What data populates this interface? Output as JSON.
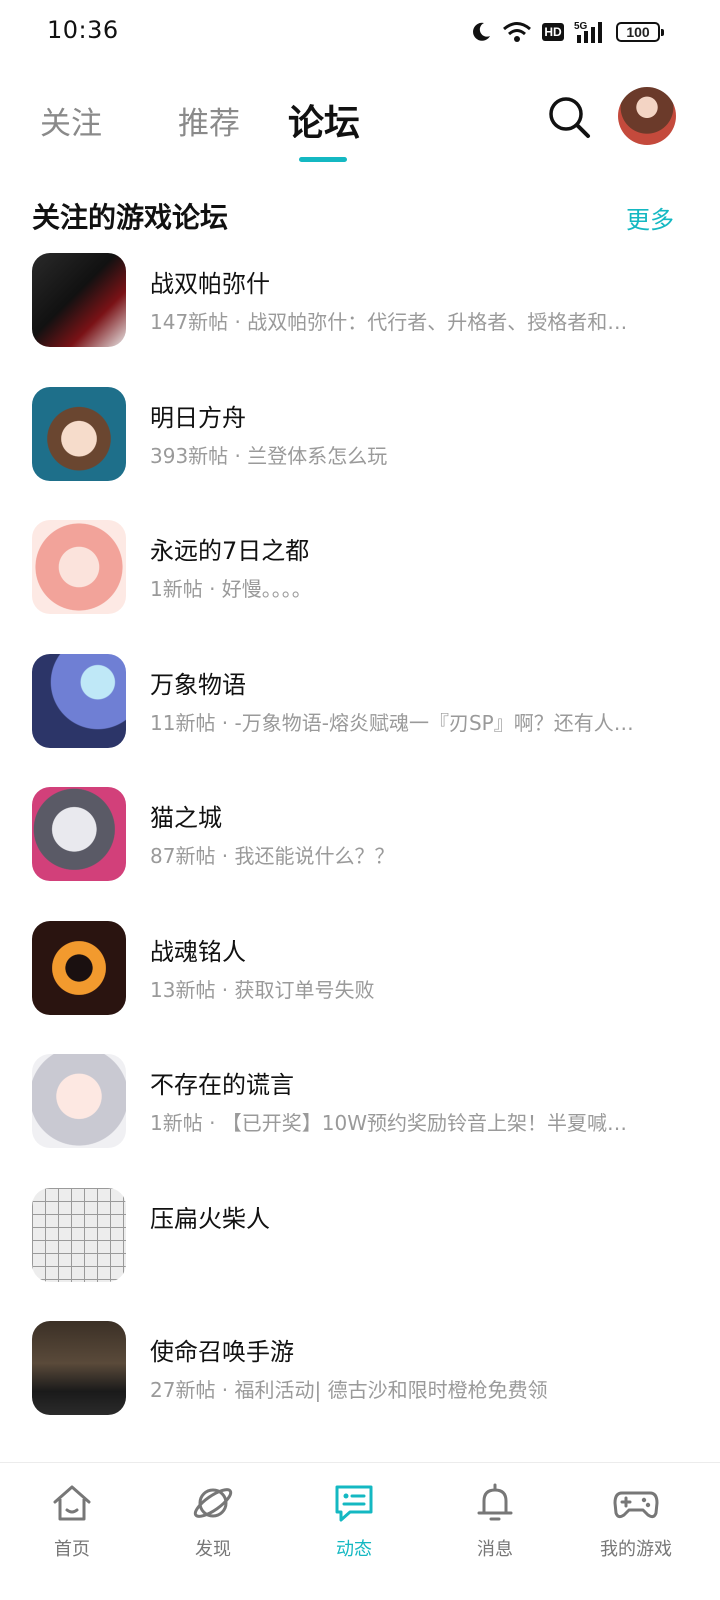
{
  "status_bar": {
    "time": "10:36",
    "hd": "HD",
    "network": "5G",
    "battery": "100"
  },
  "tabs": [
    {
      "label": "关注"
    },
    {
      "label": "推荐"
    },
    {
      "label": "论坛"
    }
  ],
  "section": {
    "title": "关注的游戏论坛",
    "more": "更多"
  },
  "forums": [
    {
      "name": "战双帕弥什",
      "meta": "147新帖 · 战双帕弥什：代行者、升格者、授格者和…",
      "icon": "game-punishing"
    },
    {
      "name": "明日方舟",
      "meta": "393新帖 · 兰登体系怎么玩",
      "icon": "game-arknights"
    },
    {
      "name": "永远的7日之都",
      "meta": "1新帖 · 好慢。。。。",
      "icon": "game-7days"
    },
    {
      "name": "万象物语",
      "meta": "11新帖 · -万象物语-熔炎赋魂一『刃SP』啊？还有人…",
      "icon": "game-sdorica"
    },
    {
      "name": "猫之城",
      "meta": "87新帖 · 我还能说什么？？",
      "icon": "game-catcity"
    },
    {
      "name": "战魂铭人",
      "meta": "13新帖 · 获取订单号失败",
      "icon": "game-soulknight"
    },
    {
      "name": "不存在的谎言",
      "meta": "1新帖 · 【已开奖】10W预约奖励铃音上架！半夏喊…",
      "icon": "game-lies"
    },
    {
      "name": "压扁火柴人",
      "meta": "",
      "icon": "game-stickman"
    },
    {
      "name": "使命召唤手游",
      "meta": "27新帖 · 福利活动| 德古沙和限时橙枪免费领",
      "icon": "game-callofduty"
    }
  ],
  "bottom_nav": [
    {
      "label": "首页",
      "icon": "home-icon"
    },
    {
      "label": "发现",
      "icon": "discover-icon"
    },
    {
      "label": "动态",
      "icon": "feed-icon"
    },
    {
      "label": "消息",
      "icon": "bell-icon"
    },
    {
      "label": "我的游戏",
      "icon": "gamepad-icon"
    }
  ],
  "colors": {
    "accent": "#14b8c2",
    "text": "#111111",
    "muted": "#9a9a9a"
  }
}
